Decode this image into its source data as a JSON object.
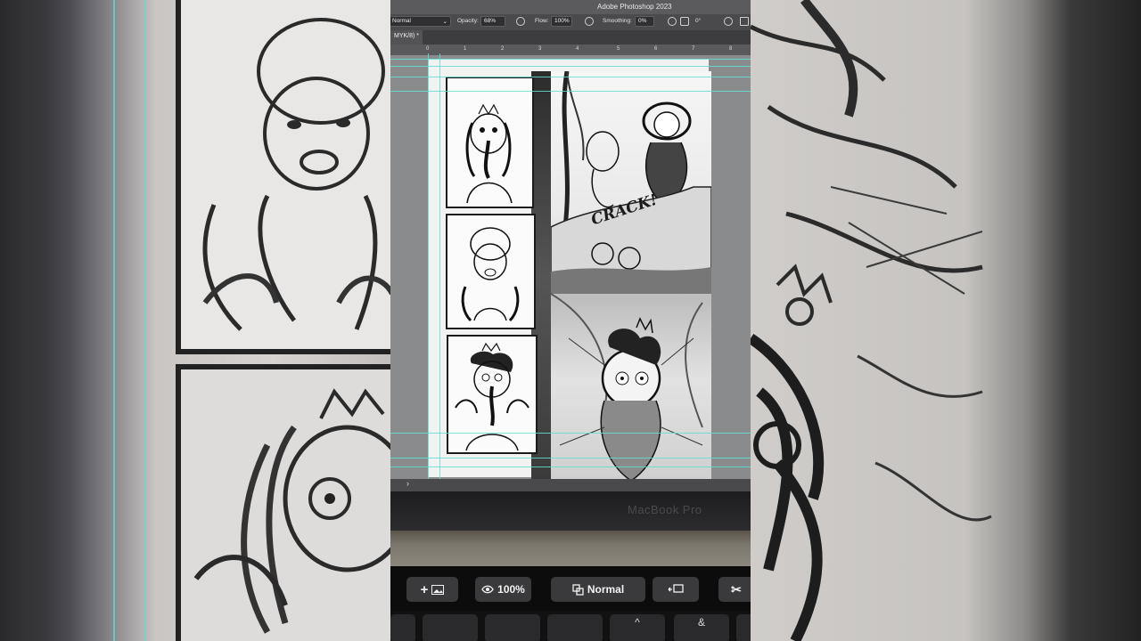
{
  "app": {
    "title": "Adobe Photoshop 2023",
    "document_tab": "MYK/8) *"
  },
  "options_bar": {
    "blend_mode": "Normal",
    "opacity_label": "Opacity:",
    "opacity_value": "68%",
    "flow_label": "Flow:",
    "flow_value": "100%",
    "smoothing_label": "Smoothing:",
    "smoothing_value": "0%",
    "angle_value": "0°"
  },
  "ruler": {
    "ticks": [
      "0",
      "1",
      "2",
      "3",
      "4",
      "5",
      "6",
      "7",
      "8"
    ]
  },
  "comic": {
    "sound_effect": "CRACK!"
  },
  "canvas_footer": {
    "arrow": "›"
  },
  "laptop": {
    "brand": "MacBook Pro"
  },
  "touch_bar": {
    "zoom_value": "100%",
    "blend_mode": "Normal"
  },
  "keyboard": {
    "keys": [
      "",
      "",
      "^",
      "&",
      ""
    ]
  },
  "colors": {
    "guide": "#5fe0d3",
    "panel_border": "#1b1b1b",
    "touchbar_button": "#3a3a3c"
  }
}
